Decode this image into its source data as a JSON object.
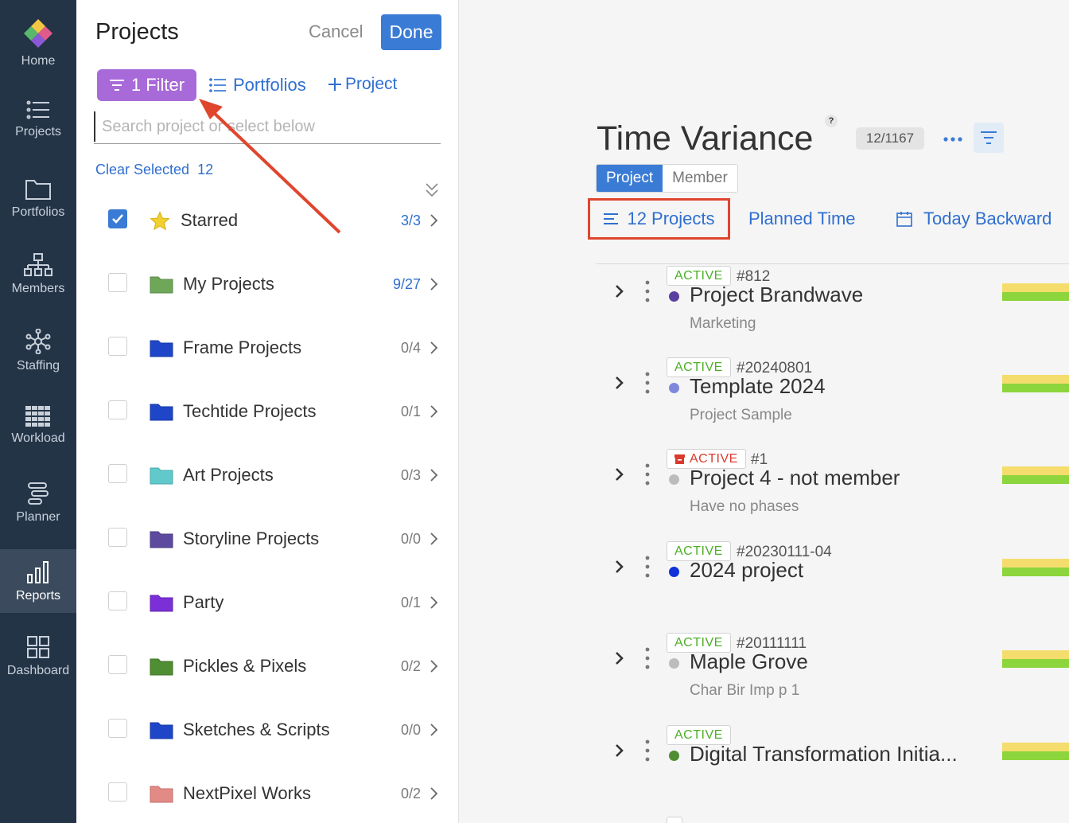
{
  "nav": {
    "items": [
      {
        "label": "Home",
        "icon": "home-logo-icon",
        "active": false
      },
      {
        "label": "Projects",
        "icon": "list-icon",
        "active": false
      },
      {
        "label": "Portfolios",
        "icon": "folder-icon",
        "active": false
      },
      {
        "label": "Members",
        "icon": "org-chart-icon",
        "active": false
      },
      {
        "label": "Staffing",
        "icon": "network-icon",
        "active": false
      },
      {
        "label": "Workload",
        "icon": "grid-icon",
        "active": false
      },
      {
        "label": "Planner",
        "icon": "planner-icon",
        "active": false
      },
      {
        "label": "Reports",
        "icon": "bar-chart-icon",
        "active": true
      },
      {
        "label": "Dashboard",
        "icon": "dashboard-icon",
        "active": false
      }
    ]
  },
  "picker": {
    "title": "Projects",
    "cancel_label": "Cancel",
    "done_label": "Done",
    "filter_label": "1 Filter",
    "portfolios_label": "Portfolios",
    "add_project_label": "Project",
    "search_placeholder": "Search project or select below",
    "clear_selected_label": "Clear Selected",
    "clear_selected_count": "12",
    "rows": [
      {
        "label": "Starred",
        "count": "3/3",
        "checked": true,
        "icon": "star-icon",
        "color": "#f2d12e",
        "count_blue": true
      },
      {
        "label": "My Projects",
        "count": "9/27",
        "checked": false,
        "icon": "folder-icon",
        "color": "#6fa759",
        "count_blue": true
      },
      {
        "label": "Frame Projects",
        "count": "0/4",
        "checked": false,
        "icon": "folder-icon",
        "color": "#1f46c8",
        "count_blue": false
      },
      {
        "label": "Techtide Projects",
        "count": "0/1",
        "checked": false,
        "icon": "folder-icon",
        "color": "#1f46c8",
        "count_blue": false
      },
      {
        "label": "Art Projects",
        "count": "0/3",
        "checked": false,
        "icon": "folder-icon",
        "color": "#62c9cb",
        "count_blue": false
      },
      {
        "label": "Storyline Projects",
        "count": "0/0",
        "checked": false,
        "icon": "folder-icon",
        "color": "#5d4a9e",
        "count_blue": false
      },
      {
        "label": "Party",
        "count": "0/1",
        "checked": false,
        "icon": "folder-icon",
        "color": "#7b2fd6",
        "count_blue": false
      },
      {
        "label": "Pickles & Pixels",
        "count": "0/2",
        "checked": false,
        "icon": "folder-icon",
        "color": "#4f8e33",
        "count_blue": false
      },
      {
        "label": "Sketches & Scripts",
        "count": "0/0",
        "checked": false,
        "icon": "folder-icon",
        "color": "#1f46c8",
        "count_blue": false
      },
      {
        "label": "NextPixel Works",
        "count": "0/2",
        "checked": false,
        "icon": "folder-icon",
        "color": "#e28a86",
        "count_blue": false
      }
    ]
  },
  "report": {
    "title": "Time Variance",
    "help_mark": "?",
    "count_badge": "12/1167",
    "tabs": [
      {
        "label": "Project",
        "active": true
      },
      {
        "label": "Member",
        "active": false
      }
    ],
    "projects_filter_label": "12 Projects",
    "planned_time_label": "Planned Time",
    "date_range_label": "Today Backward",
    "projects": [
      {
        "status": "ACTIVE",
        "status_archived": false,
        "number": "#812",
        "name": "Project Brandwave",
        "sub": "Marketing",
        "dot_color": "#5b3fa0"
      },
      {
        "status": "ACTIVE",
        "status_archived": false,
        "number": "#20240801",
        "name": "Template 2024",
        "sub": "Project Sample",
        "dot_color": "#7f87dd"
      },
      {
        "status": "ACTIVE",
        "status_archived": true,
        "number": "#1",
        "name": "Project 4 - not member",
        "sub": "Have no phases",
        "dot_color": "#bcbcbc"
      },
      {
        "status": "ACTIVE",
        "status_archived": false,
        "number": "#20230111-04",
        "name": "2024 project",
        "sub": "",
        "dot_color": "#1032d8"
      },
      {
        "status": "ACTIVE",
        "status_archived": false,
        "number": "#20111111",
        "name": "Maple Grove",
        "sub": "Char Bir Imp p 1",
        "dot_color": "#bcbcbc"
      },
      {
        "status": "ACTIVE",
        "status_archived": false,
        "number": "",
        "name": "Digital Transformation Initia...",
        "sub": "",
        "dot_color": "#4f8e33"
      }
    ]
  },
  "colors": {
    "accent": "#3a7bd5",
    "link": "#2f6fd0",
    "filter_purple": "#a86ad8",
    "highlight_red": "#e0452e",
    "nav_bg": "#243447"
  }
}
